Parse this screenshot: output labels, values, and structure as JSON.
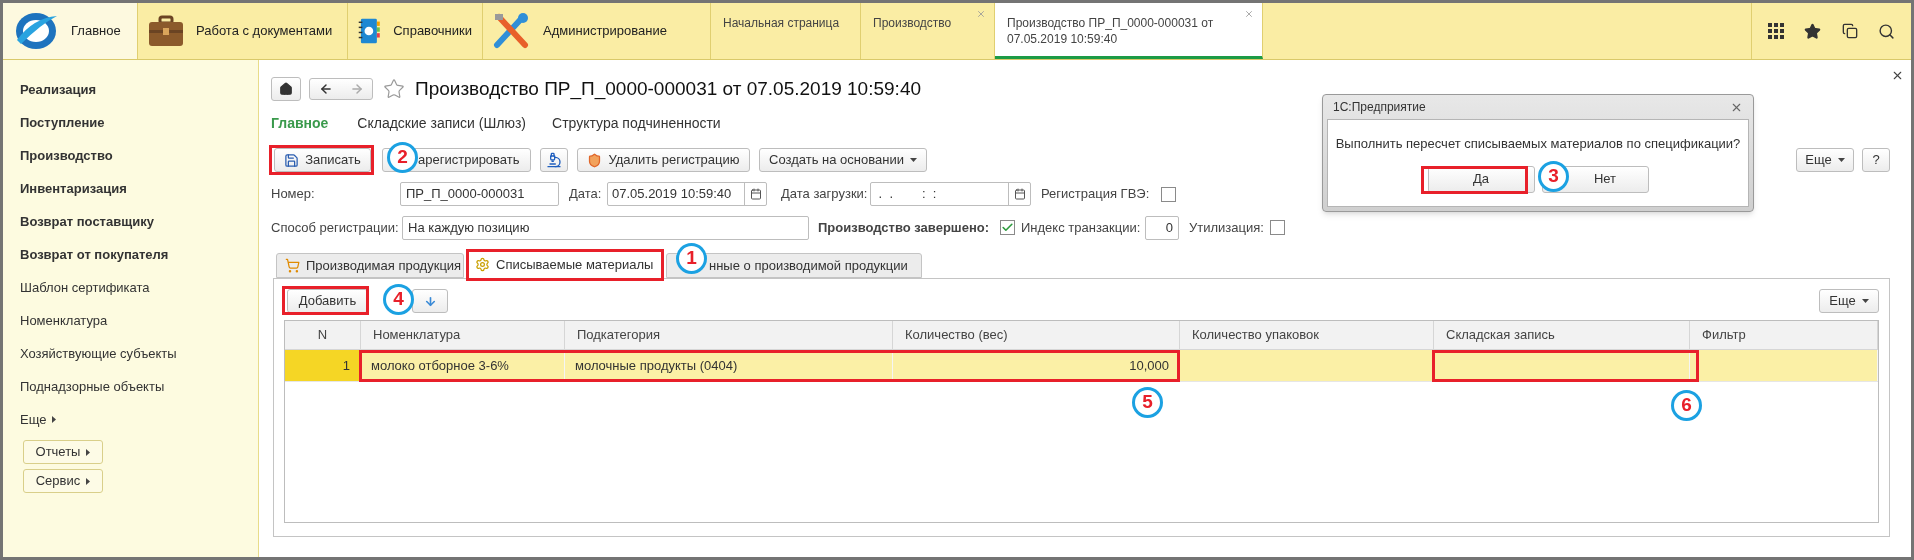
{
  "top_bar": {
    "sections": [
      {
        "label": "Главное",
        "selected": true
      },
      {
        "label": "Работа с документами",
        "selected": false
      },
      {
        "label": "Справочники",
        "selected": false
      },
      {
        "label": "Администрирование",
        "selected": false
      }
    ],
    "open_tabs": [
      {
        "label": "Начальная страница",
        "selected": false,
        "closable": false
      },
      {
        "label": "Производство",
        "selected": false,
        "closable": true
      },
      {
        "label": "Производство ПР_П_0000-000031 от 07.05.2019 10:59:40",
        "selected": true,
        "closable": true
      }
    ]
  },
  "sidebar": {
    "items": [
      {
        "label": "Реализация",
        "bold": true
      },
      {
        "label": "Поступление",
        "bold": true
      },
      {
        "label": "Производство",
        "bold": true
      },
      {
        "label": "Инвентаризация",
        "bold": true
      },
      {
        "label": "Возврат поставщику",
        "bold": true
      },
      {
        "label": "Возврат от покупателя",
        "bold": true
      },
      {
        "label": "Шаблон сертификата",
        "bold": false
      },
      {
        "label": "Номенклатура",
        "bold": false
      },
      {
        "label": "Хозяйствующие субъекты",
        "bold": false
      },
      {
        "label": "Поднадзорные объекты",
        "bold": false
      }
    ],
    "more": "Еще",
    "buttons": [
      "Отчеты",
      "Сервис"
    ]
  },
  "form": {
    "title": "Производство ПР_П_0000-000031 от 07.05.2019 10:59:40",
    "sections": [
      {
        "label": "Главное",
        "selected": true
      },
      {
        "label": "Складские записи (Шлюз)",
        "selected": false
      },
      {
        "label": "Структура подчиненности",
        "selected": false
      }
    ],
    "toolbar": [
      {
        "label": "Записать"
      },
      {
        "label": "арегистрировать"
      },
      {
        "label": "Удалить регистрацию"
      },
      {
        "label": "Создать на основании",
        "dropdown": true
      }
    ],
    "toolbar_right": [
      {
        "label": "Еще",
        "dropdown": true
      },
      {
        "label": "?",
        "dropdown": false
      }
    ],
    "fields_row_1": [
      {
        "kind": "text",
        "label": "Номер:",
        "value": "ПР_П_0000-000031"
      },
      {
        "kind": "date",
        "label": "Дата:",
        "value": "07.05.2019 10:59:40"
      },
      {
        "kind": "date",
        "label": "Дата загрузки:",
        "value": " .  .        :  :"
      },
      {
        "kind": "checkbox",
        "label": "Регистрация ГВЭ:",
        "checked": false
      }
    ],
    "fields_row_2": [
      {
        "kind": "text",
        "label": "Способ регистрации:",
        "value": "На каждую позицию"
      },
      {
        "kind": "checkbox",
        "label": "Производство завершено:",
        "bold": true,
        "checked": true
      },
      {
        "kind": "number",
        "label": "Индекс транзакции:",
        "value": "0"
      },
      {
        "kind": "checkbox",
        "label": "Утилизация:",
        "checked": false
      }
    ],
    "tabs": [
      {
        "label": "Производимая продукция",
        "selected": false
      },
      {
        "label": "Списываемые материалы",
        "selected": true
      },
      {
        "label": "нные о производимой продукции",
        "selected": false
      }
    ],
    "table_toolbar": {
      "add": "Добавить",
      "more": "Еще"
    },
    "table": {
      "columns": [
        "N",
        "Номенклатура",
        "Подкатегория",
        "Количество (вес)",
        "Количество упаковок",
        "Складская запись",
        "Фильтр"
      ],
      "rows": [
        {
          "selected": true,
          "cells": [
            "1",
            "молоко отборное 3-6%",
            "молочные продукты (0404)",
            "10,000"
          ]
        }
      ]
    }
  },
  "dialog": {
    "title": "1С:Предприятие",
    "message": "Выполнить пересчет списываемых материалов по спецификации?",
    "buttons": [
      "Да",
      "Нет"
    ]
  },
  "annotations": [
    {
      "label": "1"
    },
    {
      "label": "2"
    },
    {
      "label": "3"
    },
    {
      "label": "4"
    },
    {
      "label": "5"
    },
    {
      "label": "6"
    }
  ]
}
